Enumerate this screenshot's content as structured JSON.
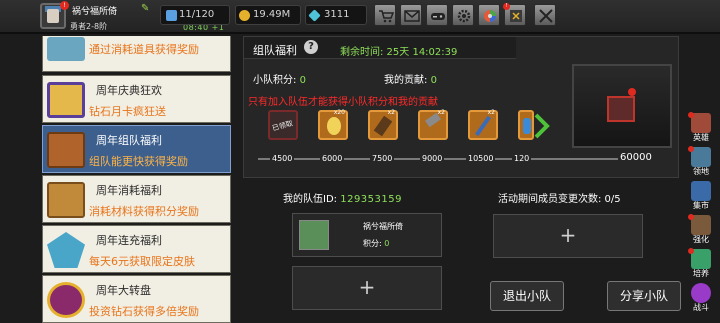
{
  "player": {
    "name": "祸兮福所倚",
    "rank": "勇者2-8阶",
    "clock": "08:40 +1"
  },
  "stats": [
    {
      "label": "11/120",
      "icon": "stamina-icon",
      "color": "#5aa0e0"
    },
    {
      "label": "19.49M",
      "icon": "gold-coin-icon",
      "color": "#e5b02c"
    },
    {
      "label": "3111",
      "icon": "diamond-icon",
      "color": "#4fc2d8"
    }
  ],
  "toolbar_icons": [
    "shop-cart-icon",
    "mail-icon",
    "gamepad-icon",
    "settings-gear-icon",
    "color-wheel-icon",
    "battle-pass-icon",
    "swords-icon"
  ],
  "events": [
    {
      "title": "",
      "desc": "通过消耗道具获得奖励",
      "icon": "potion-bag-icon",
      "icon_color": "#6aa6c0",
      "active": false
    },
    {
      "title": "周年庆典狂欢",
      "desc": "钻石月卡疯狂送",
      "icon": "purple-card-icon",
      "icon_color": "#5a3f9a",
      "active": false
    },
    {
      "title": "周年组队福利",
      "desc": "组队能更快获得奖励",
      "icon": "treasure-chest-icon",
      "icon_color": "#b0632a",
      "active": true
    },
    {
      "title": "周年消耗福利",
      "desc": "消耗材料获得积分奖励",
      "icon": "open-chest-icon",
      "icon_color": "#c08a3a",
      "active": false
    },
    {
      "title": "周年连充福利",
      "desc": "每天6元获取限定皮肤",
      "icon": "ice-crystal-icon",
      "icon_color": "#4aa6c8",
      "active": false
    },
    {
      "title": "周年大转盘",
      "desc": "投资钻石获得多倍奖励",
      "icon": "wheel-icon",
      "icon_color": "#8a2a6a",
      "active": false
    }
  ],
  "panel": {
    "title": "组队福利",
    "time_label": "剩余时间: 25天 14:02:39",
    "team_score_label": "小队积分:",
    "team_score": "0",
    "contribution_label": "我的贡献:",
    "contribution": "0",
    "warning": "只有加入队伍才能获得小队积分和我的贡献",
    "claimed_label": "已领取"
  },
  "rewards": [
    {
      "name": "dark-chest-icon",
      "count": "",
      "claimed": true
    },
    {
      "name": "golden-egg-icon",
      "count": "x20",
      "claimed": false
    },
    {
      "name": "scroll-icon",
      "count": "x2",
      "claimed": false
    },
    {
      "name": "hammer-icon",
      "count": "x2",
      "claimed": false
    },
    {
      "name": "staff-icon",
      "count": "x2",
      "claimed": false
    },
    {
      "name": "blue-bottle-icon",
      "count": "",
      "claimed": false
    }
  ],
  "progress": {
    "ticks": [
      "4500",
      "6000",
      "7500",
      "9000",
      "10500",
      "120"
    ],
    "final": "60000"
  },
  "team": {
    "id_label": "我的队伍ID:",
    "id": "129353159",
    "change_label": "活动期间成员变更次数: 0/5",
    "member_name": "祸兮福所倚",
    "member_score_label": "积分:",
    "member_score": "0",
    "add_symbol": "+",
    "leave_label": "退出小队",
    "share_label": "分享小队"
  },
  "side_nav": [
    {
      "label": "英雄",
      "icon": "hero-icon",
      "color": "#a04a3a",
      "dot": true
    },
    {
      "label": "领地",
      "icon": "territory-icon",
      "color": "#4a7a9a",
      "dot": true
    },
    {
      "label": "集市",
      "icon": "market-icon",
      "color": "#3a6aa8",
      "dot": false
    },
    {
      "label": "强化",
      "icon": "enhance-icon",
      "color": "#7a5a3a",
      "dot": true
    },
    {
      "label": "培养",
      "icon": "train-icon",
      "color": "#3aa06a",
      "dot": true
    },
    {
      "label": "战斗",
      "icon": "battle-portal-icon",
      "color": "#9a3ac8",
      "dot": false
    }
  ]
}
